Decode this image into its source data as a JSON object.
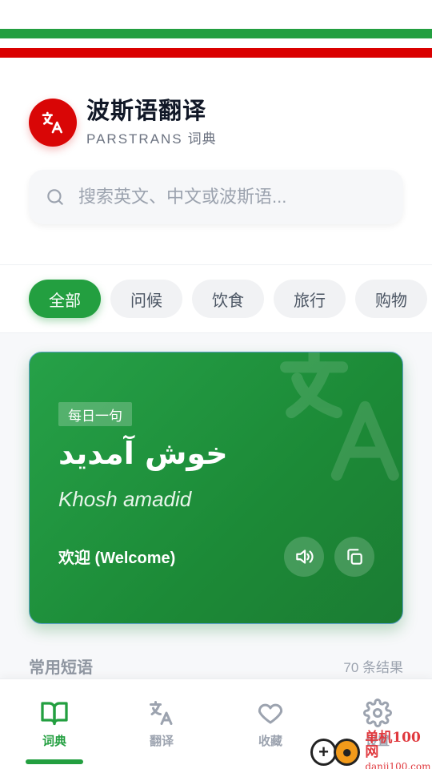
{
  "app": {
    "title": "波斯语翻译",
    "subtitle_en": "PARSTRANS",
    "subtitle_cn": "词典"
  },
  "colors": {
    "brand_green": "#239f40",
    "brand_red": "#da0000",
    "card_green": "#1c8a37"
  },
  "search": {
    "placeholder": "搜索英文、中文或波斯语..."
  },
  "categories": [
    {
      "label": "全部",
      "active": true
    },
    {
      "label": "问候",
      "active": false
    },
    {
      "label": "饮食",
      "active": false
    },
    {
      "label": "旅行",
      "active": false
    },
    {
      "label": "购物",
      "active": false
    }
  ],
  "daily_card": {
    "badge": "每日一句",
    "persian": "خوش آمدید",
    "romanization": "Khosh amadid",
    "meaning": "欢迎 (Welcome)",
    "sound_icon": "speaker-icon",
    "copy_icon": "copy-icon"
  },
  "phrases_section": {
    "title": "常用短语",
    "count": "70 条结果"
  },
  "bottom_nav": [
    {
      "label": "词典",
      "icon": "book-open-icon",
      "active": true
    },
    {
      "label": "翻译",
      "icon": "translate-icon",
      "active": false
    },
    {
      "label": "收藏",
      "icon": "heart-icon",
      "active": false
    },
    {
      "label": "设置",
      "icon": "gear-icon",
      "active": false
    }
  ],
  "watermark": {
    "cn": "单机100网",
    "url": "danji100.com"
  }
}
